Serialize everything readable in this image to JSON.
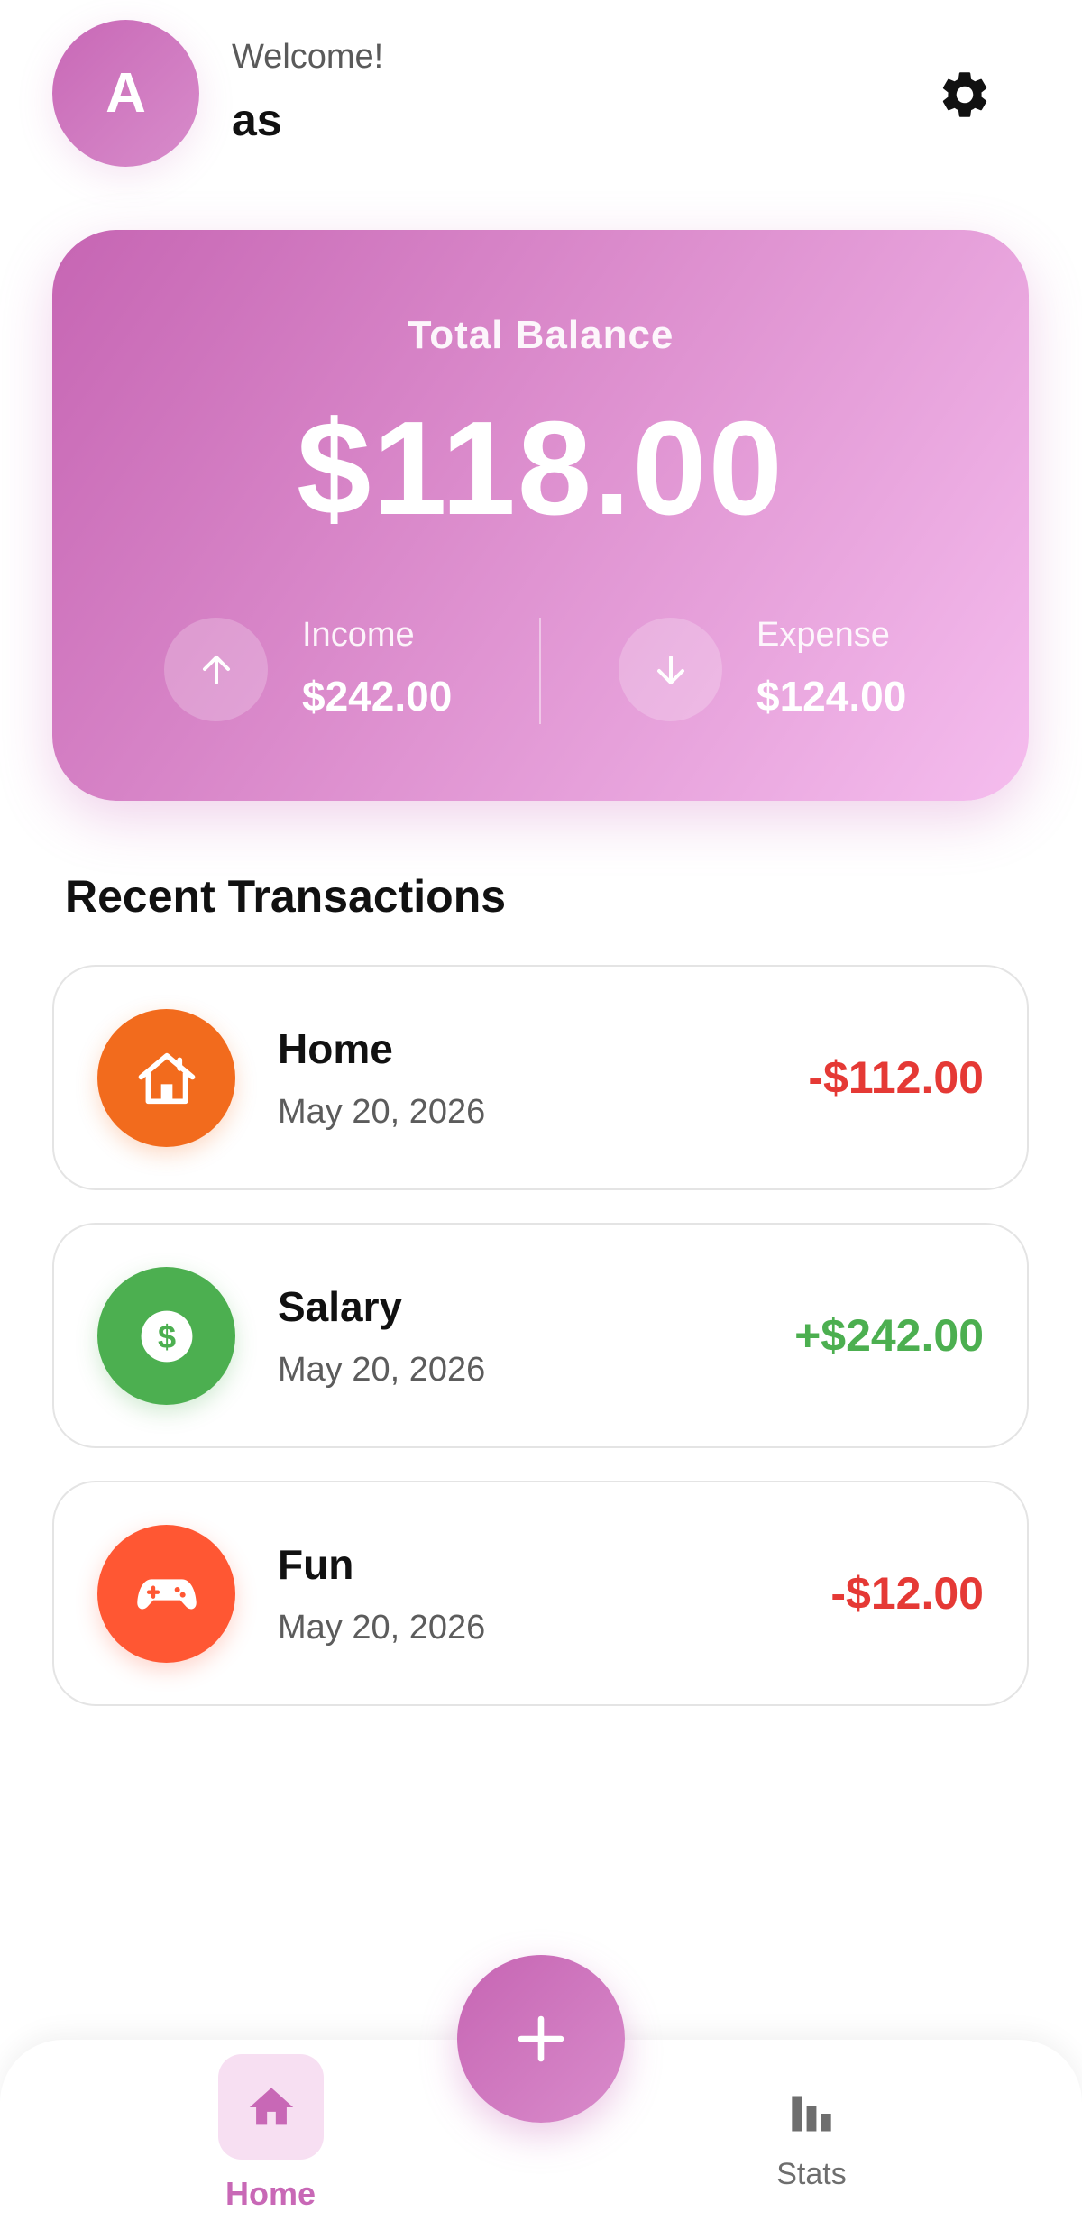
{
  "header": {
    "avatar_initial": "A",
    "welcome_text": "Welcome!",
    "username": "as",
    "settings_icon": "gear-icon"
  },
  "balance_card": {
    "label": "Total Balance",
    "amount": "$118.00",
    "income": {
      "label": "Income",
      "value": "$242.00",
      "icon": "arrow-up-icon"
    },
    "expense": {
      "label": "Expense",
      "value": "$124.00",
      "icon": "arrow-down-icon"
    },
    "gradient_start": "#c665b3",
    "gradient_end": "#f5bdee"
  },
  "recent": {
    "title": "Recent Transactions",
    "transactions": [
      {
        "name": "Home",
        "date": "May 20, 2026",
        "amount": "-$112.00",
        "icon": "house-icon",
        "icon_color": "#f26b1d",
        "amount_color": "#e53935"
      },
      {
        "name": "Salary",
        "date": "May 20, 2026",
        "amount": "+$242.00",
        "icon": "dollar-icon",
        "icon_color": "#4caf50",
        "amount_color": "#4caf50"
      },
      {
        "name": "Fun",
        "date": "May 20, 2026",
        "amount": "-$12.00",
        "icon": "gamepad-icon",
        "icon_color": "#ff5733",
        "amount_color": "#e53935"
      }
    ]
  },
  "bottom_nav": {
    "home_label": "Home",
    "stats_label": "Stats",
    "fab_icon": "plus-icon",
    "accent": "#c868b6"
  }
}
